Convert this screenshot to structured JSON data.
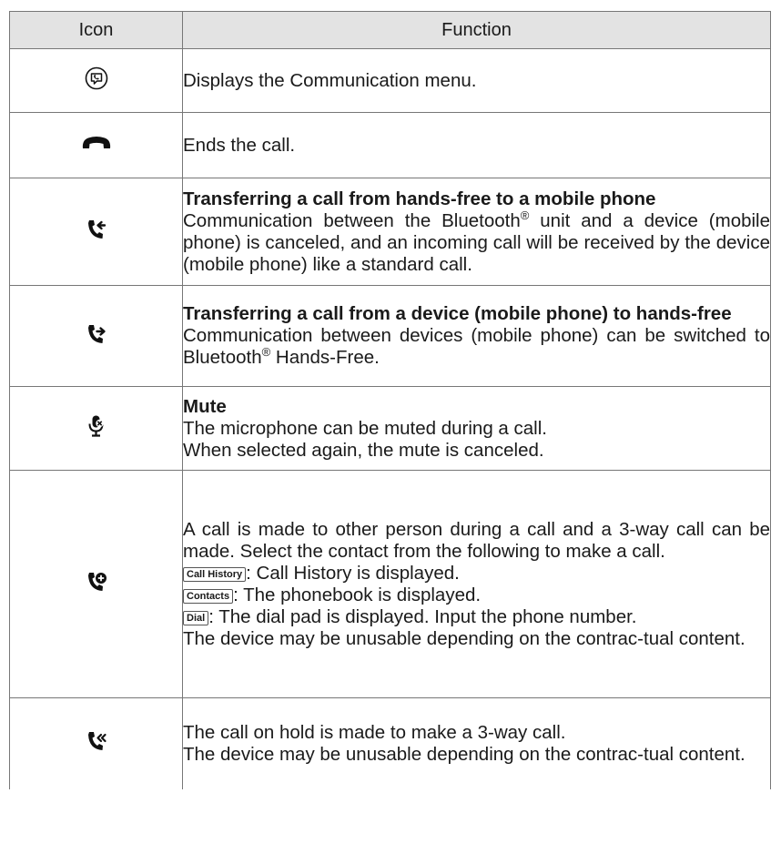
{
  "header": {
    "icon_col": "Icon",
    "function_col": "Function"
  },
  "rows": [
    {
      "icon": "communication-menu-icon",
      "text": "Displays the Communication menu."
    },
    {
      "icon": "end-call-icon",
      "text": "Ends the call."
    },
    {
      "icon": "transfer-to-phone-icon",
      "heading": "Transferring a call from hands-free to a mobile phone",
      "body_pre": "Communication between the Bluetooth",
      "reg": "®",
      "body_post": " unit and a device (mobile phone) is canceled, and an incoming call will be received by the device (mobile phone) like a standard call."
    },
    {
      "icon": "transfer-to-handsfree-icon",
      "heading": "Transferring a call from a device (mobile phone) to hands-free",
      "body_pre": "Communication between devices (mobile phone) can be switched to Bluetooth",
      "reg": "®",
      "body_post": " Hands-Free."
    },
    {
      "icon": "mute-microphone-icon",
      "heading": "Mute",
      "line1": "The microphone can be muted during a call.",
      "line2": "When selected again, the mute is canceled."
    },
    {
      "icon": "add-call-icon",
      "intro": "A call is made to other person during a call and a 3-way call can be made. Select the contact from the following to make a call.",
      "options": [
        {
          "button": "Call History",
          "desc": ": Call History is displayed."
        },
        {
          "button": "Contacts",
          "desc": ": The phonebook is displayed."
        },
        {
          "button": "Dial",
          "desc": ": The dial pad is displayed. Input the phone number."
        }
      ],
      "note": "The device may be unusable depending on the contrac-tual content."
    },
    {
      "icon": "merge-calls-icon",
      "line1": "The call on hold is made to make a 3-way call.",
      "note": "The device may be unusable depending on the contrac-tual content."
    }
  ]
}
